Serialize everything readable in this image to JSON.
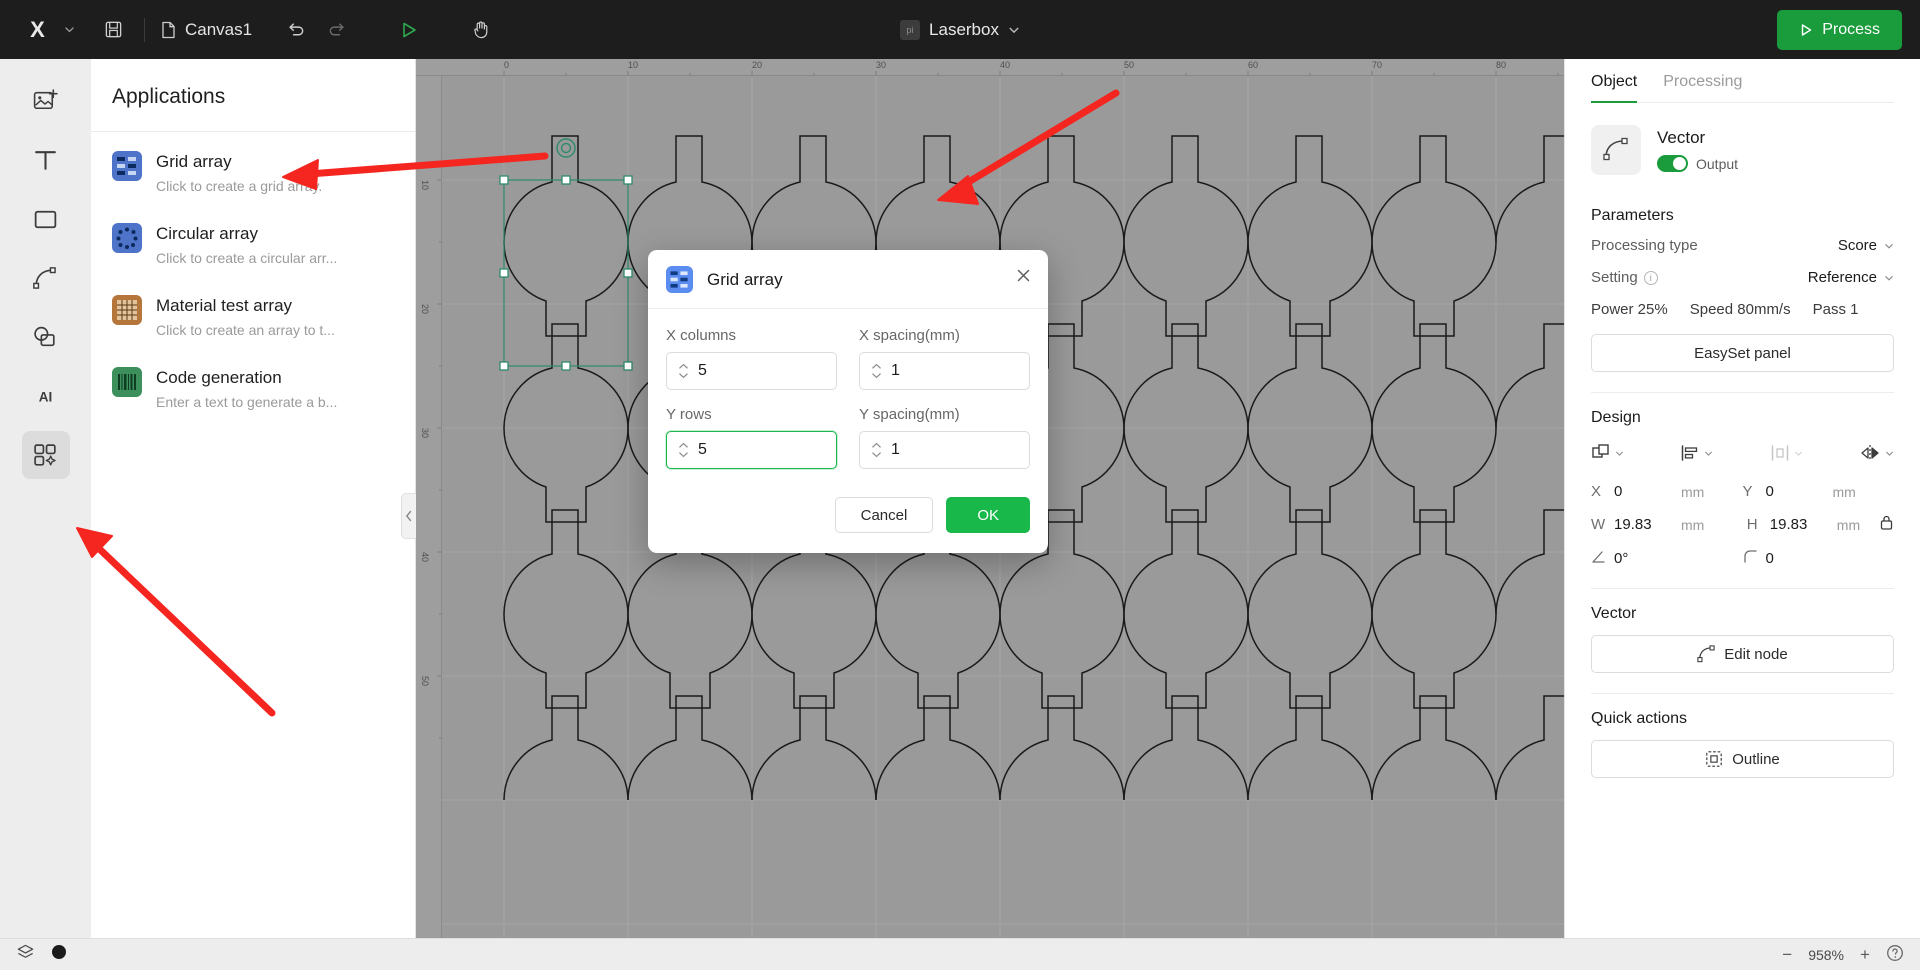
{
  "topbar": {
    "logo": "X",
    "logo_caret_icon": "chevron-down-icon",
    "save_icon": "save-icon",
    "doc_icon": "file-icon",
    "doc_name": "Canvas1",
    "undo_icon": "undo-icon",
    "redo_icon": "redo-icon",
    "play_icon": "play-icon",
    "hand_icon": "hand-icon",
    "device_badge": "pi",
    "device_name": "Laserbox",
    "device_caret_icon": "chevron-down-icon",
    "process_label": "Process",
    "process_icon": "play-triangle-icon",
    "process_color": "#1a9b3c"
  },
  "rail": {
    "items": [
      {
        "name": "image-tool",
        "icon": "image-plus-icon"
      },
      {
        "name": "text-tool",
        "icon": "text-T-icon"
      },
      {
        "name": "rectangle-tool",
        "icon": "rectangle-icon"
      },
      {
        "name": "pen-tool",
        "icon": "pen-node-icon"
      },
      {
        "name": "shapes-tool",
        "icon": "shapes-icon"
      },
      {
        "name": "ai-tool",
        "icon": "ai-icon"
      },
      {
        "name": "applications-tool",
        "icon": "grid-apps-icon"
      }
    ],
    "active_index": 6
  },
  "apps_panel": {
    "title": "Applications",
    "collapse_icon": "chevron-left-icon",
    "items": [
      {
        "name": "Grid array",
        "desc": "Click to create a grid array.",
        "icon": "grid-array-icon",
        "color": "#4d74c8"
      },
      {
        "name": "Circular array",
        "desc": "Click to create a circular arr...",
        "icon": "circular-array-icon",
        "color": "#4d74c8"
      },
      {
        "name": "Material test array",
        "desc": "Click to create an array to t...",
        "icon": "material-test-icon",
        "color": "#b5763c"
      },
      {
        "name": "Code generation",
        "desc": "Enter a text to generate a b...",
        "icon": "code-generation-icon",
        "color": "#3d8f5c"
      }
    ]
  },
  "canvas": {
    "ruler_h_ticks": [
      "0",
      "10",
      "20",
      "30",
      "40",
      "50",
      "60",
      "70",
      "80"
    ],
    "ruler_v_ticks": [
      "10",
      "20",
      "30",
      "40",
      "50"
    ],
    "rotate_handle_icon": "rotate-handle-icon"
  },
  "modal": {
    "icon": "grid-array-icon",
    "title": "Grid array",
    "close_icon": "close-icon",
    "fields": [
      {
        "label": "X columns",
        "value": "5",
        "name": "x-columns-input",
        "focused": false
      },
      {
        "label": "X spacing(mm)",
        "value": "1",
        "name": "x-spacing-input",
        "focused": false
      },
      {
        "label": "Y rows",
        "value": "5",
        "name": "y-rows-input",
        "focused": true
      },
      {
        "label": "Y spacing(mm)",
        "value": "1",
        "name": "y-spacing-input",
        "focused": false
      }
    ],
    "cancel_label": "Cancel",
    "ok_label": "OK",
    "ok_color": "#18b84a"
  },
  "right_panel": {
    "tabs": [
      {
        "label": "Object",
        "active": true
      },
      {
        "label": "Processing",
        "active": false
      }
    ],
    "object": {
      "icon": "vector-node-icon",
      "type": "Vector",
      "output_label": "Output",
      "output_on": true
    },
    "parameters": {
      "title": "Parameters",
      "processing_type_label": "Processing type",
      "processing_type_value": "Score",
      "setting_label": "Setting",
      "setting_info_icon": "info-icon",
      "setting_value": "Reference",
      "specs": [
        "Power 25%",
        "Speed 80mm/s",
        "Pass 1"
      ],
      "easyset_label": "EasySet panel"
    },
    "design": {
      "title": "Design",
      "tools": [
        {
          "name": "arrange-icon",
          "dim": false
        },
        {
          "name": "align-left-icon",
          "dim": false
        },
        {
          "name": "distribute-icon",
          "dim": true
        },
        {
          "name": "flip-horizontal-icon",
          "dim": false
        }
      ],
      "x_label": "X",
      "x_value": "0",
      "x_unit": "mm",
      "y_label": "Y",
      "y_value": "0",
      "y_unit": "mm",
      "w_label": "W",
      "w_value": "19.83",
      "w_unit": "mm",
      "h_label": "H",
      "h_value": "19.83",
      "h_unit": "mm",
      "lock_icon": "lock-icon",
      "angle_label": "angle-icon",
      "angle_value": "0°",
      "radius_label": "radius-icon",
      "radius_value": "0"
    },
    "vector": {
      "title": "Vector",
      "edit_node_label": "Edit node",
      "edit_node_icon": "node-icon"
    },
    "quick_actions": {
      "title": "Quick actions",
      "outline_label": "Outline",
      "outline_icon": "outline-icon"
    }
  },
  "bottom": {
    "layers_icon": "layers-icon",
    "color_swatch": "#1b1b1b",
    "zoom_out_icon": "minus-icon",
    "zoom_value": "958%",
    "zoom_in_icon": "plus-icon",
    "help_icon": "help-icon"
  },
  "annotations": {
    "arrow_color": "#f5251f",
    "arrows": [
      {
        "name": "arrow-to-grid-array-item"
      },
      {
        "name": "arrow-to-canvas-top"
      },
      {
        "name": "arrow-to-applications-tool"
      }
    ]
  }
}
